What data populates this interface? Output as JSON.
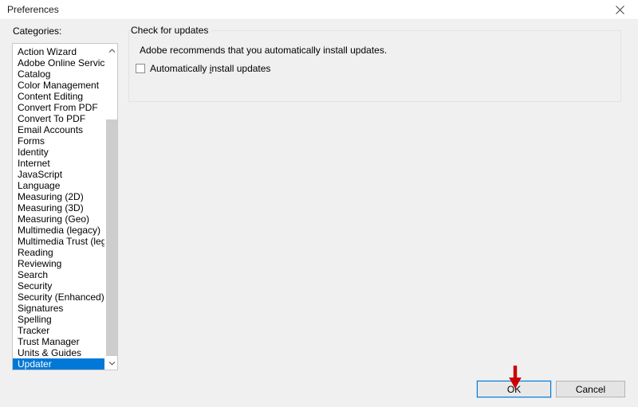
{
  "window": {
    "title": "Preferences",
    "close_icon": "close-icon"
  },
  "sidebar": {
    "label": "Categories:",
    "scroll_up_icon": "chevron-up-icon",
    "scroll_down_icon": "chevron-down-icon",
    "selected": "Updater",
    "items": [
      "Action Wizard",
      "Adobe Online Services",
      "Catalog",
      "Color Management",
      "Content Editing",
      "Convert From PDF",
      "Convert To PDF",
      "Email Accounts",
      "Forms",
      "Identity",
      "Internet",
      "JavaScript",
      "Language",
      "Measuring (2D)",
      "Measuring (3D)",
      "Measuring (Geo)",
      "Multimedia (legacy)",
      "Multimedia Trust (legacy)",
      "Reading",
      "Reviewing",
      "Search",
      "Security",
      "Security (Enhanced)",
      "Signatures",
      "Spelling",
      "Tracker",
      "Trust Manager",
      "Units & Guides",
      "Updater"
    ]
  },
  "main": {
    "group_title": "Check for updates",
    "description": "Adobe recommends that you automatically install updates.",
    "checkbox": {
      "label_before": "Automatically ",
      "label_accel": "i",
      "label_after": "nstall updates",
      "checked": false
    }
  },
  "footer": {
    "ok_label": "OK",
    "cancel_label": "Cancel"
  },
  "annotation": {
    "arrow_color": "#cc0000",
    "arrow_icon": "down-arrow-annotation"
  },
  "colors": {
    "selection_blue": "#0078d7",
    "dialog_background": "#f0f0f0",
    "annotation_red": "#cc0000"
  }
}
